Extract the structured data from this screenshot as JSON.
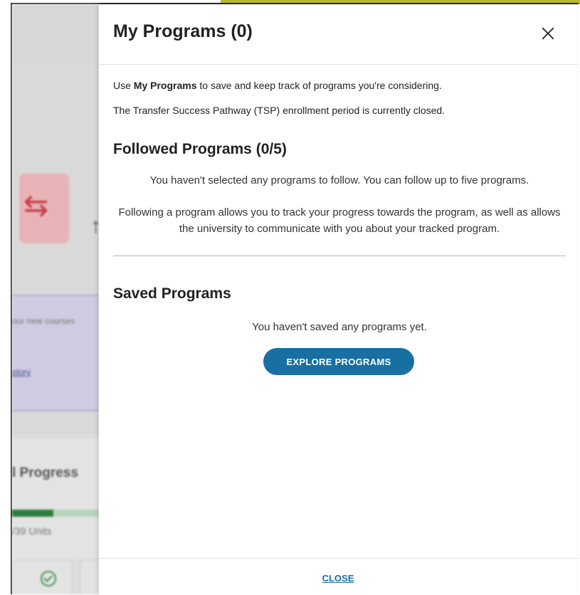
{
  "background": {
    "progress_title": "l Progress",
    "units_text": "/39 Units",
    "purple_text": "our new courses",
    "purple_link": "story"
  },
  "modal": {
    "title": "My Programs (0)",
    "intro_prefix": "Use ",
    "intro_bold": "My Programs",
    "intro_suffix": " to save and keep track of programs you're considering.",
    "notice": "The Transfer Success Pathway (TSP) enrollment period is currently closed.",
    "followed": {
      "title": "Followed Programs (0/5)",
      "empty_text": "You haven't selected any programs to follow. You can follow up to five programs.",
      "info_text": "Following a program allows you to track your progress towards the program, as well as allows the university to communicate with you about your tracked program."
    },
    "saved": {
      "title": "Saved Programs",
      "empty_text": "You haven't saved any programs yet.",
      "explore_button": "EXPLORE PROGRAMS"
    },
    "footer": {
      "close_label": "CLOSE"
    }
  },
  "colors": {
    "accent": "#176fa2",
    "progress_green": "#2f7d3e",
    "highlight_strip": "#b9bd2f"
  }
}
